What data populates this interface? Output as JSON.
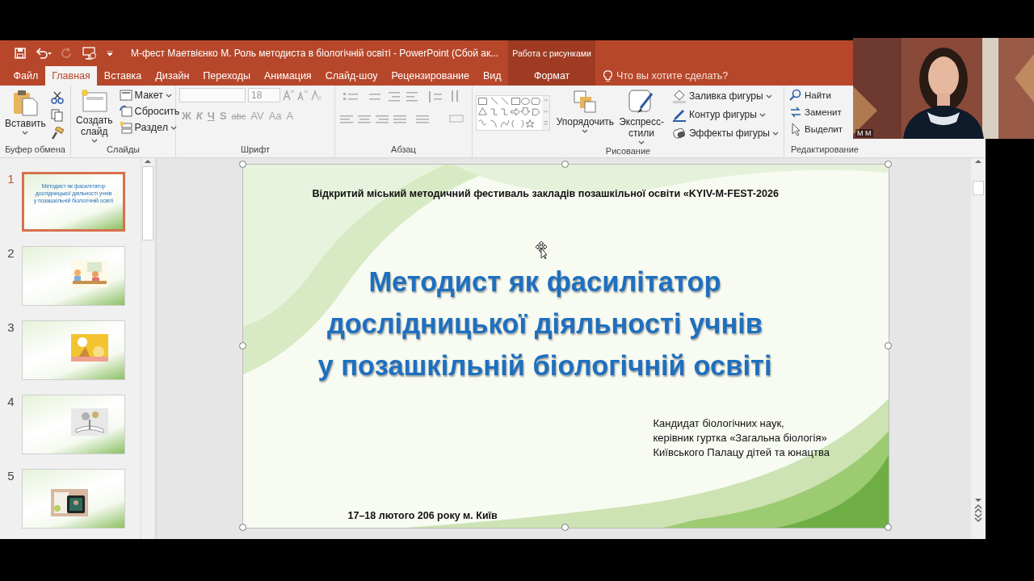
{
  "title_bar": {
    "title": "М-фест Маетвієнко М. Роль методиста в біологічній освіті - PowerPoint (Сбой ак...",
    "context_group": "Работа с рисунками"
  },
  "tabs": [
    {
      "label": "Файл",
      "kind": "file",
      "selected": false
    },
    {
      "label": "Главная",
      "kind": "tab",
      "selected": true
    },
    {
      "label": "Вставка",
      "kind": "tab",
      "selected": false
    },
    {
      "label": "Дизайн",
      "kind": "tab",
      "selected": false
    },
    {
      "label": "Переходы",
      "kind": "tab",
      "selected": false
    },
    {
      "label": "Анимация",
      "kind": "tab",
      "selected": false
    },
    {
      "label": "Слайд-шоу",
      "kind": "tab",
      "selected": false
    },
    {
      "label": "Рецензирование",
      "kind": "tab",
      "selected": false
    },
    {
      "label": "Вид",
      "kind": "tab",
      "selected": false
    },
    {
      "label": "Формат",
      "kind": "context",
      "selected": false
    }
  ],
  "tell_me": {
    "placeholder": "Что вы хотите сделать?"
  },
  "ribbon": {
    "groups": [
      {
        "kind": "clipboard",
        "label": "Буфер обмена",
        "paste": "Вставить"
      },
      {
        "kind": "slides",
        "label": "Слайды",
        "new_slide": "Создать слайд",
        "items": [
          "Макет",
          "Сбросить",
          "Раздел"
        ]
      },
      {
        "kind": "font",
        "label": "Шрифт",
        "font_size": "18",
        "disabled": true,
        "format_buttons": [
          "Ж",
          "К",
          "Ч",
          "S",
          "abc",
          "AV",
          "Aa",
          "A"
        ]
      },
      {
        "kind": "paragraph",
        "label": "Абзац"
      },
      {
        "kind": "drawing",
        "label": "Рисование",
        "arrange": "Упорядочить",
        "quick_styles": "Экспресс-стили",
        "items": [
          "Заливка фигуры",
          "Контур фигуры",
          "Эффекты фигуры"
        ]
      },
      {
        "kind": "editing",
        "label": "Редактирование",
        "items": [
          "Найти",
          "Заменит",
          "Выделит"
        ]
      }
    ]
  },
  "thumbnails": [
    {
      "number": "1",
      "kind": "title",
      "selected": true,
      "title_lines": [
        "Методист як фасилітатор",
        "дослідницької діяльності учнів",
        "у позашкільній біологічній освіті"
      ]
    },
    {
      "number": "2",
      "kind": "picture",
      "selected": false
    },
    {
      "number": "3",
      "kind": "picture",
      "selected": false
    },
    {
      "number": "4",
      "kind": "picture",
      "selected": false
    },
    {
      "number": "5",
      "kind": "picture",
      "selected": false
    }
  ],
  "slide": {
    "header": "Відкритий міський методичний фестиваль закладів позашкільної освіти «KYIV-M-FEST-2026",
    "title_lines": [
      "Методист як фасилітатор",
      "дослідницької діяльності учнів",
      "у позашкільній біологічній освіті"
    ],
    "author_lines": [
      "Кандидат біологічних наук,",
      "керівник гуртка «Загальна біологія»",
      "Київського Палацу дітей та юнацтва"
    ],
    "date": "17–18 лютого 206 року м. Київ"
  },
  "webcam": {
    "name_label": "М М"
  }
}
